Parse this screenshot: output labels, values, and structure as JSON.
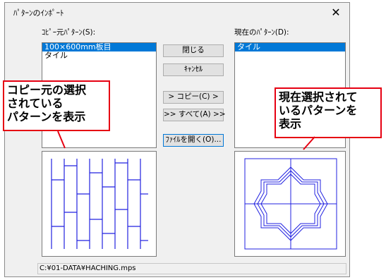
{
  "dialog": {
    "title": "ﾊﾟﾀｰﾝのｲﾝﾎﾟｰﾄ",
    "close_glyph": "✕"
  },
  "source": {
    "label": "ｺﾋﾟｰ元ﾊﾟﾀｰﾝ(S):",
    "items": [
      {
        "label": "100×600mm板目",
        "selected": true
      },
      {
        "label": "タイル",
        "selected": false
      }
    ]
  },
  "current": {
    "label": "現在のﾊﾟﾀｰﾝ(D):",
    "items": [
      {
        "label": "タイル",
        "selected": true
      }
    ]
  },
  "buttons": {
    "close": "閉じる",
    "cancel": "ｷｬﾝｾﾙ",
    "copy": "> コピー(C) >",
    "all": ">> すべて(A) >>",
    "open_file": "ﾌｧｲﾙを開く(O)..."
  },
  "status": {
    "path": "C:¥01-DATA¥HACHING.mps"
  },
  "callouts": {
    "left": [
      "コピー元の選択",
      "されている",
      "パターンを表示"
    ],
    "right": [
      "現在選択されて",
      "いるパターンを",
      "表示"
    ]
  },
  "colors": {
    "pattern": "#2020e0",
    "callout_border": "#e60012",
    "selection": "#0078d7"
  }
}
